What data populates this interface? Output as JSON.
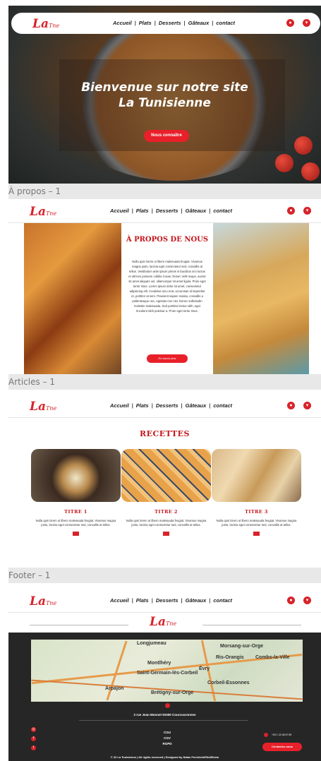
{
  "brand": {
    "logo_text": "La",
    "logo_suffix": "Tne"
  },
  "nav": {
    "links": [
      "Accueil",
      "Plats",
      "Desserts",
      "Gâteaux",
      "contact"
    ],
    "separator": "|"
  },
  "frames": {
    "about_label": "À propos – 1",
    "articles_label": "Articles – 1",
    "footer_label": "Footer – 1"
  },
  "hero": {
    "title_line1": "Bienvenue sur notre site",
    "title_line2": "La Tunisienne",
    "cta_label": "Nous connaître"
  },
  "about": {
    "heading": "À PROPOS DE NOUS",
    "paragraph": "Nulla quis lorem ut libero malesuada feugiat. Vivamus magna justo, lacinia eget consectetur sed, convallis at tellus. Vestibulum ante ipsum primis in faucibus orci luctus et ultrices posuere cubilia Curae; Donec velit neque, auctor sit amet aliquam vel, ullamcorper sit amet ligula. Proin eget tortor risus. Lorem ipsum dolor sit amet, consectetur adipiscing elit. Curabitur arcu erat, accumsan id imperdiet et, porttitor at sem. Praesent sapien massa, convallis a pellentesque nec, egestas non nisi. Donec sollicitudin molestie malesuada. Sed porttitor lectus nibh, eget tincidunt nibh pulvinar a. Proin eget tortor risus.",
    "button_label": "En savoir plus"
  },
  "articles": {
    "heading": "RECETTES",
    "cards": [
      {
        "title": "TITRE 1",
        "desc": "Nulla quis lorem ut libero malesuada feugiat. Vivamus magna justo, lacinia eget consectetur sed, convallis at tellus."
      },
      {
        "title": "TITRE 2",
        "desc": "Nulla quis lorem ut libero malesuada feugiat. Vivamus magna justo, lacinia eget consectetur sed, convallis at tellus."
      },
      {
        "title": "TITRE 3",
        "desc": "Nulla quis lorem ut libero malesuada feugiat. Vivamus magna justo, lacinia eget consectetur sed, convallis at tellus."
      }
    ]
  },
  "map": {
    "cities": [
      "Longjumeau",
      "Morsang-sur-Orge",
      "Montlhéry",
      "Évry",
      "Corbeil-Essonnes",
      "Arpajon",
      "Brétigny-sur-Orge",
      "Saint-Germain-lès-Corbeil",
      "Combs-la-Ville",
      "Ris-Orangis"
    ]
  },
  "footer": {
    "address": "2 rue Jean Monnet 91000 Courcouronnes",
    "legal": [
      "CGU",
      "CGV",
      "RGPD"
    ],
    "phone": "+33 1 23 45 67 89",
    "contact_button": "Contactez-nous",
    "copyright": "© 22 La Tunisienne | All rights reserved | Designed by Safae Ferchichi/ElixiElixim"
  },
  "colors": {
    "accent": "#d8232a",
    "footer_bg": "#262626"
  }
}
